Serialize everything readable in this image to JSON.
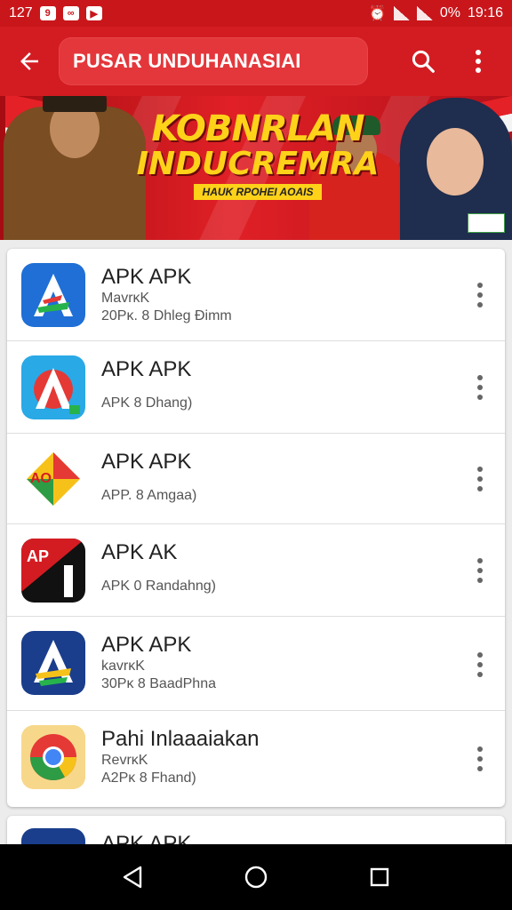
{
  "status_bar": {
    "left_text": "127",
    "battery": "0%",
    "time": "19:16"
  },
  "app_bar": {
    "title": "PUSAR UNDUHANASIAI",
    "back_icon": "arrow-left-icon",
    "search_icon": "search-icon",
    "menu_icon": "more-vert-icon"
  },
  "banner": {
    "line1": "KOBNRLAN",
    "line2": "INDUCREMRA",
    "line3": "HAUK RPOHEI AOAIS"
  },
  "apps": [
    {
      "name": "APK APK",
      "line1": "MavrĸK",
      "line2": "20Pĸ. 8 Dhleg Đimm"
    },
    {
      "name": "APK APK",
      "line1": "",
      "line2": "APK 8 Dhang)"
    },
    {
      "name": "APK APK",
      "line1": "",
      "line2": "APP. 8 Amgaa)"
    },
    {
      "name": "APK AK",
      "line1": "",
      "line2": "APK 0 Randahng)"
    },
    {
      "name": "APK APK",
      "line1": "kavrĸK",
      "line2": "30Pĸ 8 BaadPhna"
    },
    {
      "name": "Pahi Inlaaaiakan",
      "line1": "RevrĸK",
      "line2": "A2Pĸ 8 Fhand)"
    }
  ],
  "partial_item": {
    "name": "APK APK"
  },
  "colors": {
    "primary": "#d31c22",
    "statusbar": "#c8161b"
  }
}
